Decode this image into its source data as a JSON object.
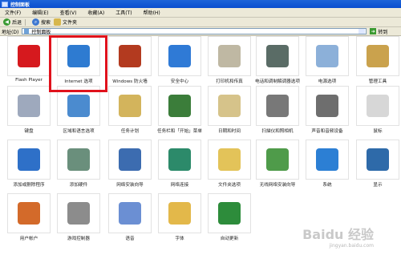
{
  "window": {
    "title": "控制面板"
  },
  "menu": [
    "文件(F)",
    "编辑(E)",
    "查看(V)",
    "收藏(A)",
    "工具(T)",
    "帮助(H)"
  ],
  "toolbar": {
    "back": "后退",
    "search": "搜索",
    "folders": "文件夹"
  },
  "address": {
    "label": "地址(D)",
    "value": "控制面板",
    "go": "转到"
  },
  "items": [
    {
      "label": "Flash Player",
      "icon": "flash-icon",
      "color": "#d6191e"
    },
    {
      "label": "Internet 选项",
      "icon": "internet-options-icon",
      "color": "#2e7bd1"
    },
    {
      "label": "Windows 防火墙",
      "icon": "firewall-icon",
      "color": "#b33a1f"
    },
    {
      "label": "安全中心",
      "icon": "security-shield-icon",
      "color": "#2f7ad6"
    },
    {
      "label": "打印机和传真",
      "icon": "printer-icon",
      "color": "#bfb8a3"
    },
    {
      "label": "电话和调制解调器选项",
      "icon": "phone-modem-icon",
      "color": "#5a6c66"
    },
    {
      "label": "电源选项",
      "icon": "power-options-icon",
      "color": "#8cb0d9"
    },
    {
      "label": "管理工具",
      "icon": "admin-tools-icon",
      "color": "#caa24d"
    },
    {
      "label": "键盘",
      "icon": "keyboard-icon",
      "color": "#9ea9bd"
    },
    {
      "label": "区域和语言选项",
      "icon": "region-language-icon",
      "color": "#4b8bcf"
    },
    {
      "label": "任务计划",
      "icon": "task-scheduler-icon",
      "color": "#d3b45c"
    },
    {
      "label": "任务栏和「开始」菜单",
      "icon": "taskbar-start-icon",
      "color": "#3b7d3a"
    },
    {
      "label": "日期和时间",
      "icon": "date-time-icon",
      "color": "#d6c38a"
    },
    {
      "label": "扫描仪和照相机",
      "icon": "scanner-camera-icon",
      "color": "#787878"
    },
    {
      "label": "声音和音频设备",
      "icon": "sound-icon",
      "color": "#6e6e6e"
    },
    {
      "label": "鼠标",
      "icon": "mouse-icon",
      "color": "#d7d7d7"
    },
    {
      "label": "添加或删除程序",
      "icon": "add-remove-programs-icon",
      "color": "#2e70c8"
    },
    {
      "label": "添加硬件",
      "icon": "add-hardware-icon",
      "color": "#6a8f7c"
    },
    {
      "label": "网络安装向导",
      "icon": "network-setup-icon",
      "color": "#3c6cb0"
    },
    {
      "label": "网络连接",
      "icon": "network-connections-icon",
      "color": "#2c8a6a"
    },
    {
      "label": "文件夹选项",
      "icon": "folder-options-icon",
      "color": "#e3c359"
    },
    {
      "label": "无线网络安装向导",
      "icon": "wireless-setup-icon",
      "color": "#4f9b4a"
    },
    {
      "label": "系统",
      "icon": "system-icon",
      "color": "#2c7fd4"
    },
    {
      "label": "显示",
      "icon": "display-icon",
      "color": "#2e6aa9"
    },
    {
      "label": "用户帐户",
      "icon": "user-accounts-icon",
      "color": "#d36a2a"
    },
    {
      "label": "游戏控制器",
      "icon": "game-controller-icon",
      "color": "#8c8c8c"
    },
    {
      "label": "语音",
      "icon": "speech-icon",
      "color": "#6b8fd3"
    },
    {
      "label": "字体",
      "icon": "fonts-icon",
      "color": "#e3b84a"
    },
    {
      "label": "自动更新",
      "icon": "automatic-updates-icon",
      "color": "#2d8c3b"
    }
  ],
  "watermark": {
    "brand": "Baidu 经验",
    "url": "jingyan.baidu.com"
  }
}
